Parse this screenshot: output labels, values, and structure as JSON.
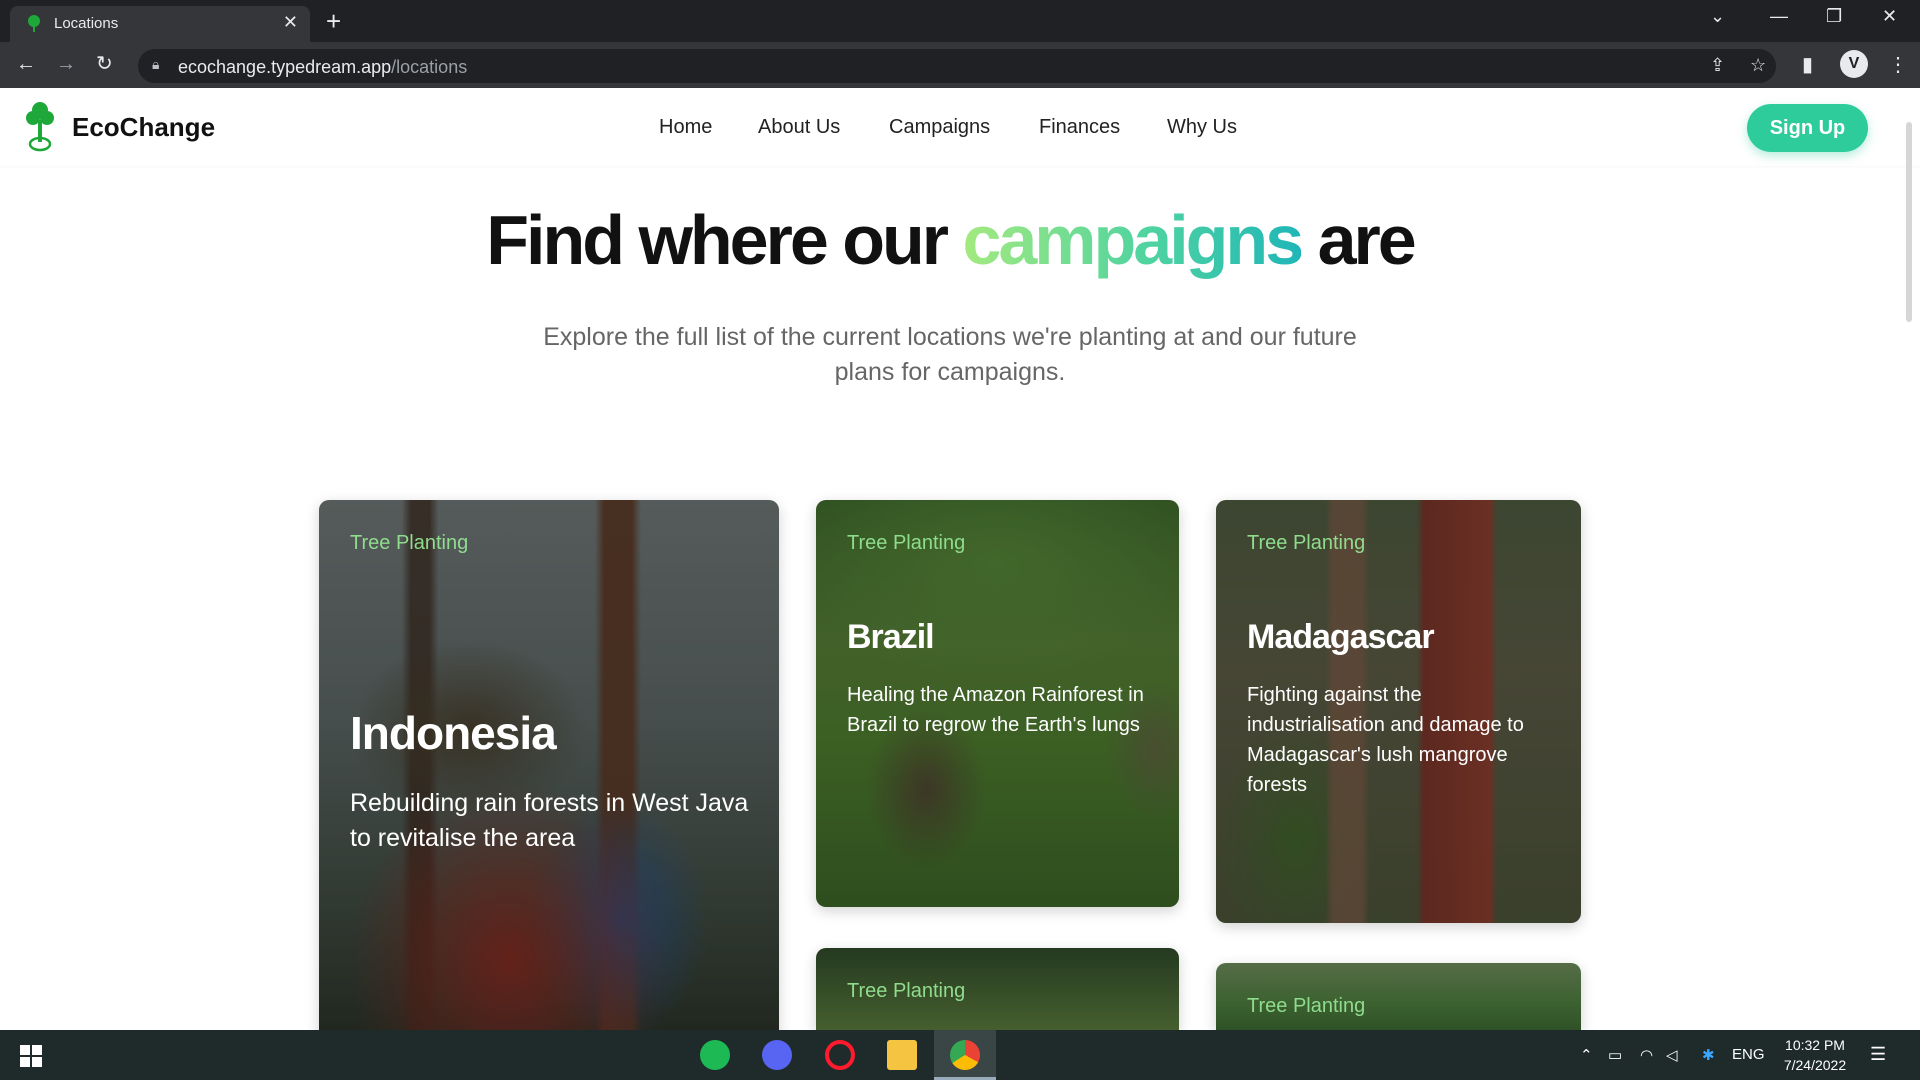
{
  "browser": {
    "tab_title": "Locations",
    "url_host": "ecochange.typedream.app",
    "url_path": "/locations",
    "profile_initial": "V"
  },
  "site": {
    "brand": "EcoChange",
    "nav": [
      "Home",
      "About Us",
      "Campaigns",
      "Finances",
      "Why Us"
    ],
    "signup_label": "Sign Up",
    "accent_color": "#2ecc9a"
  },
  "hero": {
    "title_before": "Find where our ",
    "title_highlight": "campaigns",
    "title_after": " are",
    "subtitle": "Explore the full list of the current locations we're planting at and our future plans for campaigns."
  },
  "cards": [
    {
      "tag": "Tree Planting",
      "title": "Indonesia",
      "description": "Rebuilding rain forests in West Java to revitalise the area"
    },
    {
      "tag": "Tree Planting",
      "title": "Brazil",
      "description": "Healing the Amazon Rainforest in Brazil to regrow the Earth's lungs"
    },
    {
      "tag": "Tree Planting",
      "title": "Madagascar",
      "description": "Fighting against the industrialisation and damage to Madagascar's lush mangrove forests"
    },
    {
      "tag": "Tree Planting"
    },
    {
      "tag": "Tree Planting"
    }
  ],
  "taskbar": {
    "language": "ENG",
    "time": "10:32 PM",
    "date": "7/24/2022",
    "apps": [
      "spotify-icon",
      "discord-icon",
      "opera-icon",
      "file-explorer-icon",
      "chrome-icon"
    ]
  }
}
